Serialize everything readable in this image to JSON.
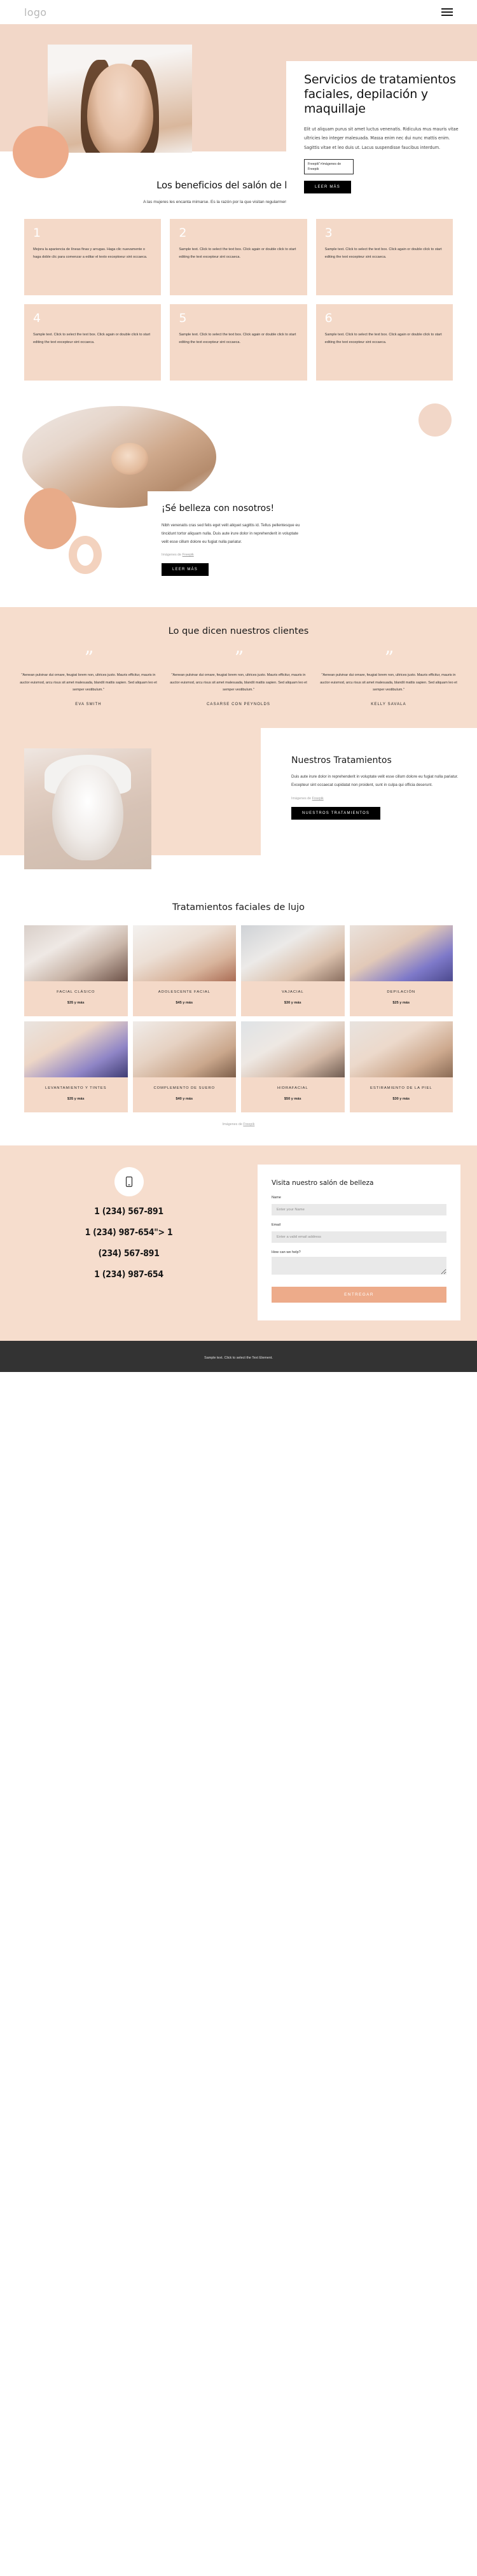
{
  "header": {
    "logo": "logo",
    "menu_icon": "hamburger-icon"
  },
  "hero": {
    "title": "Servicios de tratamientos faciales, depilación y maquillaje",
    "paragraph": "Elit ut aliquam purus sit amet luctus venenatis. Ridiculus mus mauris vitae ultricies leo integer malesuada. Massa enim nec dui nunc mattis enim. Sagittis vitae et leo duis ut. Lacus suspendisse faucibus interdum.",
    "credit": "Freepik\">Imágenes de Freepik",
    "cta": "LEER MÁS"
  },
  "benefits": {
    "title": "Los beneficios del salón de belleza.",
    "subtitle": "A las mujeres les encanta mimarse. Es la razón por la que visitan regularmente los salones de belleza.",
    "cards": [
      {
        "num": "1",
        "text": "Mejora la apariencia de líneas finas y arrugas. Haga clic nuevamente o haga doble clic para comenzar a editar el texto exceptoeur sint occaeca."
      },
      {
        "num": "2",
        "text": "Sample text. Click to select the text box. Click again or double click to start editing the text excepteur sint occaeca."
      },
      {
        "num": "3",
        "text": "Sample text. Click to select the text box. Click again or double click to start editing the text excepteur sint occaeca."
      },
      {
        "num": "4",
        "text": "Sample text. Click to select the text box. Click again or double click to start editing the text excepteur sint occaeca."
      },
      {
        "num": "5",
        "text": "Sample text. Click to select the text box. Click again or double click to start editing the text excepteur sint occaeca."
      },
      {
        "num": "6",
        "text": "Sample text. Click to select the text box. Click again or double click to start editing the text excepteur sint occaeca."
      }
    ]
  },
  "spa": {
    "title": "¡Sé belleza con nosotros!",
    "paragraph": "Nibh venenatis cras sed felis eget velit aliquet sagittis id. Tellus pellentesque eu tincidunt tortor aliquam nulla. Duis aute irure dolor in reprehenderit in voluptate velit esse cillum dolore eu fugiat nulla pariatur.",
    "credit_prefix": "Imágenes de ",
    "credit_link": "Freepik",
    "cta": "LEER MÁS"
  },
  "testimonials": {
    "title": "Lo que dicen nuestros clientes",
    "items": [
      {
        "quote": "\"Aenean pulvinar dui ornare, feugiat lorem non, ultrices justo. Mauris efficitur, mauris in auctor euismod, arcu risus sit amet malesuada, blandit mattis sapien. Sed aliquam leo et semper vestibulum.\"",
        "name": "EVA SMITH"
      },
      {
        "quote": "\"Aenean pulvinar dui ornare, feugiat lorem non, ultrices justo. Mauris efficitur, mauris in auctor euismod, arcu risus sit amet malesuada, blandit mattis sapien. Sed aliquam leo et semper vestibulum.\"",
        "name": "CASARSE CON PEYNOLDS"
      },
      {
        "quote": "\"Aenean pulvinar dui ornare, feugiat lorem non, ultrices justo. Mauris efficitur, mauris in auctor euismod, arcu risus sit amet malesuada, blandit mattis sapien. Sed aliquam leo et semper vestibulum.\"",
        "name": "KELLY SAVALA"
      }
    ]
  },
  "treatments_intro": {
    "title": "Nuestros Tratamientos",
    "paragraph": "Duis aute irure dolor in reprehenderit in voluptate velit esse cillum dolore eu fugiat nulla pariatur. Excepteur sint occaecat cupidatat non proident, sunt in culpa qui officia deserunt.",
    "credit_prefix": "Imágenes de ",
    "credit_link": "Freepik",
    "cta": "NUESTROS TRATAMIENTOS"
  },
  "luxury": {
    "title": "Tratamientos faciales de lujo",
    "credit_prefix": "Imágenes de ",
    "credit_link": "Freepik",
    "cards": [
      {
        "name": "FACIAL CLÁSICO",
        "price": "$35 y más",
        "thumb": "classic-facial-photo"
      },
      {
        "name": "ADOLESCENTE FACIAL",
        "price": "$45 y más",
        "thumb": "teen-facial-photo"
      },
      {
        "name": "VAJACIAL",
        "price": "$30 y más",
        "thumb": "vajacial-photo"
      },
      {
        "name": "DEPILACIÓN",
        "price": "$25 y más",
        "thumb": "waxing-photo"
      },
      {
        "name": "LEVANTAMIENTO Y TINTES",
        "price": "$35 y más",
        "thumb": "lift-tint-photo"
      },
      {
        "name": "COMPLEMENTO DE SUERO",
        "price": "$40 y más",
        "thumb": "serum-addon-photo"
      },
      {
        "name": "HIDRAFACIAL",
        "price": "$50 y más",
        "thumb": "hydrafacial-photo"
      },
      {
        "name": "ESTIRAMIENTO DE LA PIEL",
        "price": "$30 y más",
        "thumb": "skin-tightening-photo"
      }
    ]
  },
  "contact": {
    "icon": "phone-icon",
    "phones": [
      "1 (234) 567-891",
      "1 (234) 987-654\"> 1",
      "(234) 567-891",
      "1 (234) 987-654"
    ],
    "form_title": "Visita nuestro salón de belleza",
    "fields": [
      {
        "label": "Name",
        "placeholder": "Enter your Name",
        "value": "",
        "type": "text"
      },
      {
        "label": "Email",
        "placeholder": "Enter a valid email address",
        "value": "",
        "type": "text"
      },
      {
        "label": "How can we help?",
        "placeholder": "",
        "value": "",
        "type": "textarea"
      }
    ],
    "submit": "ENTREGAR"
  },
  "footer": {
    "text": "Sample text. Click to select the Text Element."
  },
  "colors": {
    "peach": "#f2d7c8",
    "peach_light": "#f6ddcd",
    "peach_card": "#f4d9c8",
    "accent": "#edab8a",
    "dark": "#000000",
    "footer_bg": "#333333"
  }
}
